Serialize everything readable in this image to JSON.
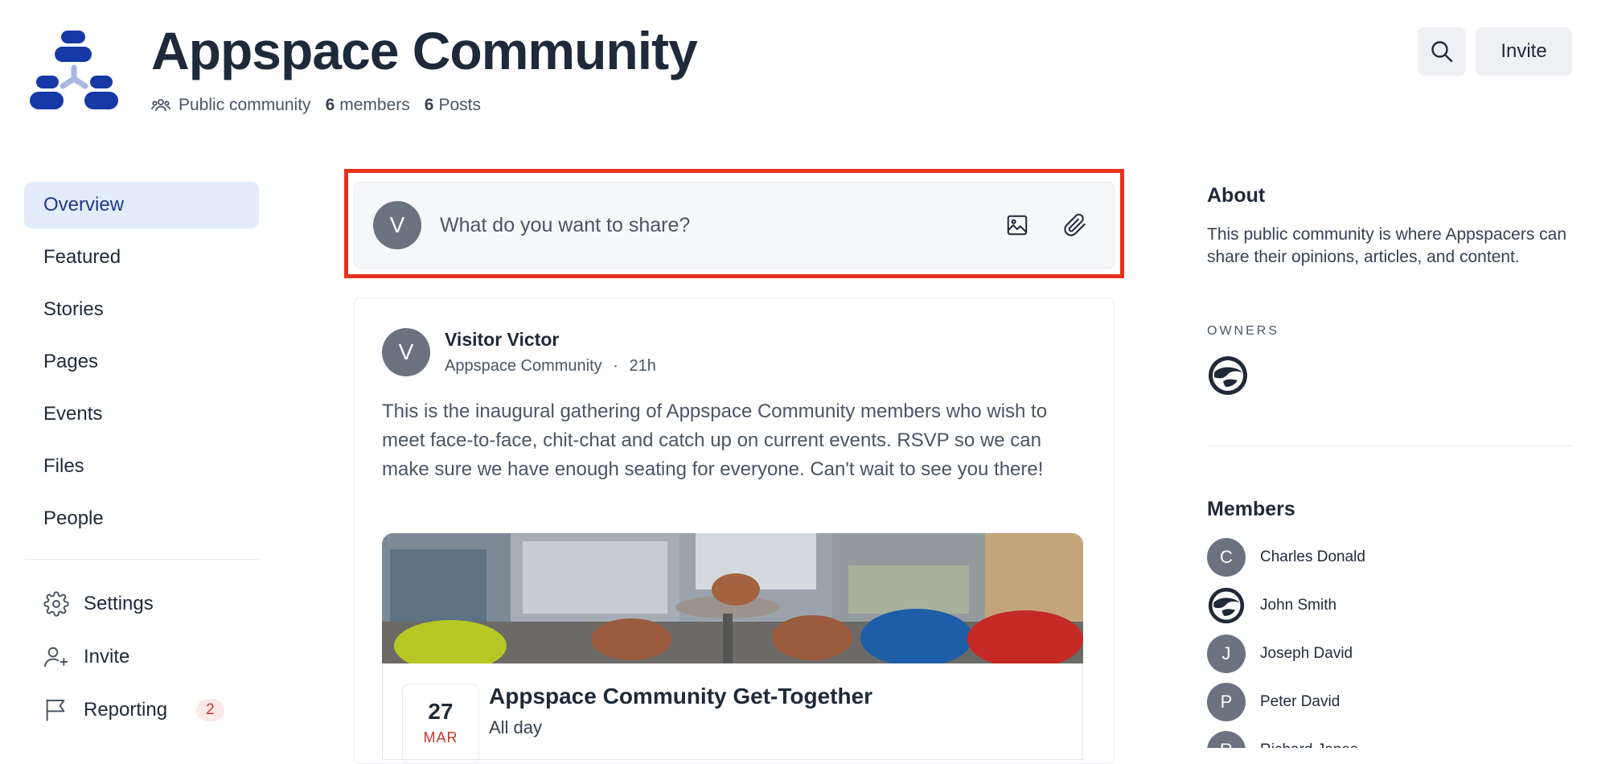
{
  "header": {
    "title": "Appspace Community",
    "visibility": "Public community",
    "members_count": "6",
    "members_label": "members",
    "posts_count": "6",
    "posts_label": "Posts",
    "invite_label": "Invite",
    "search_icon": "search-icon",
    "visibility_icon": "people-group-icon"
  },
  "sidebar": {
    "nav": [
      {
        "label": "Overview",
        "active": true
      },
      {
        "label": "Featured"
      },
      {
        "label": "Stories"
      },
      {
        "label": "Pages"
      },
      {
        "label": "Events"
      },
      {
        "label": "Files"
      },
      {
        "label": "People"
      }
    ],
    "tools": [
      {
        "label": "Settings",
        "icon": "gear-icon"
      },
      {
        "label": "Invite",
        "icon": "add-user-icon"
      },
      {
        "label": "Reporting",
        "icon": "flag-icon",
        "badge": "2"
      }
    ]
  },
  "composer": {
    "avatar_initial": "V",
    "placeholder": "What do you want to share?",
    "image_icon": "image-icon",
    "attach_icon": "paperclip-icon"
  },
  "post": {
    "avatar_initial": "V",
    "author": "Visitor Victor",
    "community": "Appspace Community",
    "separator": "·",
    "time": "21h",
    "body": "This is the inaugural gathering of Appspace Community members who wish to meet face-to-face, chit-chat and catch up on current events. RSVP so we can make sure we have enough seating for everyone. Can't wait to see you there!",
    "event": {
      "day": "27",
      "month": "MAR",
      "title": "Appspace Community Get-Together",
      "time": "All day"
    }
  },
  "about": {
    "heading": "About",
    "text": "This public community is where Appspacers can share their opinions, articles, and content.",
    "owners_label": "OWNERS"
  },
  "members": {
    "heading": "Members",
    "list": [
      {
        "initial": "C",
        "name": "Charles Donald"
      },
      {
        "initial": "",
        "name": "John Smith",
        "logo": true
      },
      {
        "initial": "J",
        "name": "Joseph David"
      },
      {
        "initial": "P",
        "name": "Peter David"
      },
      {
        "initial": "R",
        "name": "Richard Jones"
      }
    ]
  },
  "colors": {
    "accent": "#1e40af",
    "highlight": "#e8321e",
    "active_nav_bg": "#e3ecfb",
    "badge_text": "#c0392b"
  }
}
